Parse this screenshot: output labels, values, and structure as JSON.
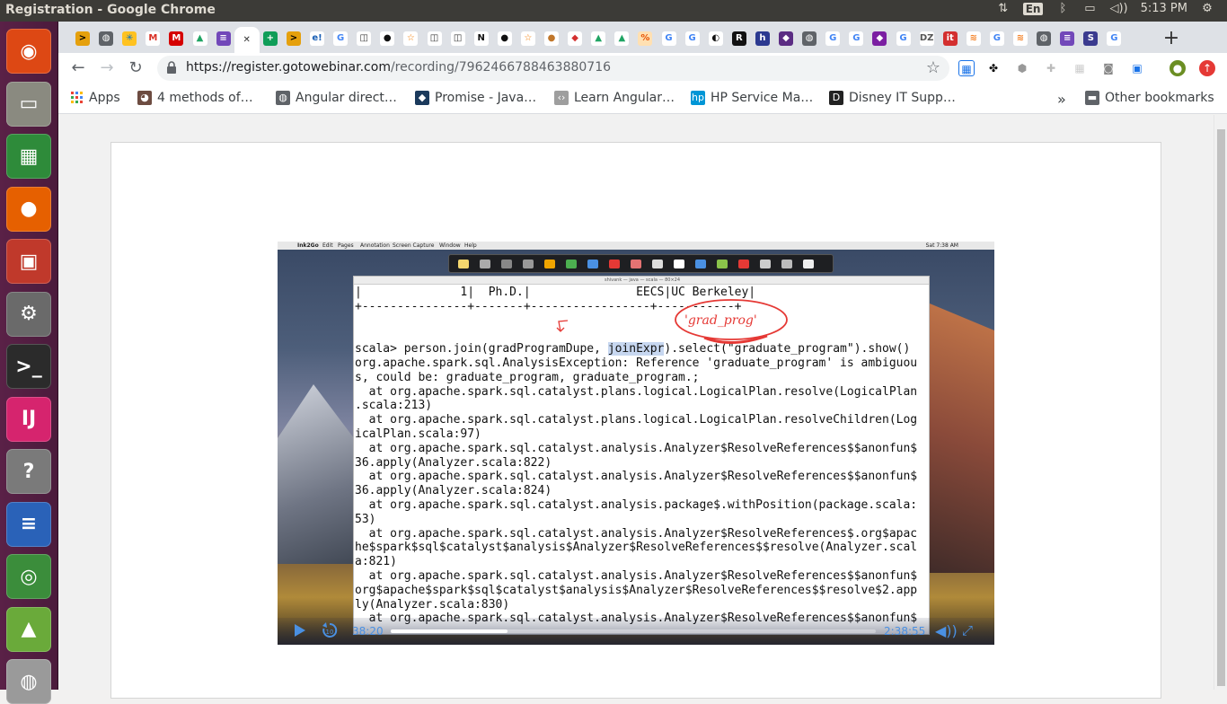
{
  "window": {
    "title": "Registration - Google Chrome"
  },
  "panel": {
    "lang": "En",
    "time": "5:13 PM"
  },
  "launcher": {
    "items": [
      {
        "name": "ubuntu-dash-icon",
        "glyph": "◉",
        "color": "#dd4814"
      },
      {
        "name": "files-icon",
        "glyph": "▭",
        "color": "#8a8a80"
      },
      {
        "name": "spreadsheet-icon",
        "glyph": "▦",
        "color": "#2e8b3a"
      },
      {
        "name": "firefox-icon",
        "glyph": "●",
        "color": "#e66000"
      },
      {
        "name": "presentation-icon",
        "glyph": "▣",
        "color": "#c0392b"
      },
      {
        "name": "system-settings-icon",
        "glyph": "⚙",
        "color": "#6a6a6a"
      },
      {
        "name": "terminal-icon",
        "glyph": ">_",
        "color": "#2b2b2b"
      },
      {
        "name": "intellij-icon",
        "glyph": "IJ",
        "color": "#d6246e"
      },
      {
        "name": "help-icon",
        "glyph": "?",
        "color": "#7a7a7a"
      },
      {
        "name": "writer-icon",
        "glyph": "≡",
        "color": "#2a62b8"
      },
      {
        "name": "chrome-icon",
        "glyph": "◎",
        "color": "#3b8d3b"
      },
      {
        "name": "image-viewer-icon",
        "glyph": "▲",
        "color": "#6aaa3a"
      },
      {
        "name": "disk-icon",
        "glyph": "◍",
        "color": "#9a9a9a"
      }
    ]
  },
  "tabs": [
    {
      "name": "tab-favicon-plex",
      "glyph": ">",
      "bg": "#e5a00d",
      "fg": "#000"
    },
    {
      "name": "tab-favicon-globe",
      "glyph": "◍",
      "bg": "#5f6368",
      "fg": "#fff"
    },
    {
      "name": "tab-favicon-walmart",
      "glyph": "✳",
      "bg": "#ffc220",
      "fg": "#0071ce"
    },
    {
      "name": "tab-favicon-gmail",
      "glyph": "M",
      "bg": "#ffffff",
      "fg": "#d93025"
    },
    {
      "name": "tab-favicon-m-red",
      "glyph": "M",
      "bg": "#d50000",
      "fg": "#fff"
    },
    {
      "name": "tab-favicon-drive",
      "glyph": "▲",
      "bg": "#ffffff",
      "fg": "#1fa463"
    },
    {
      "name": "tab-favicon-docs",
      "glyph": "≡",
      "bg": "#7248b9",
      "fg": "#fff"
    },
    {
      "name": "tab-favicon-close",
      "glyph": "✕",
      "bg": "#ffffff",
      "fg": "#333",
      "active": true
    },
    {
      "name": "tab-favicon-sheets",
      "glyph": "+",
      "bg": "#0f9d58",
      "fg": "#fff"
    },
    {
      "name": "tab-favicon-plex-2",
      "glyph": ">",
      "bg": "#e5a00d",
      "fg": "#000"
    },
    {
      "name": "tab-favicon-eloqua",
      "glyph": "e!",
      "bg": "#ffffff",
      "fg": "#1a5fb4"
    },
    {
      "name": "tab-favicon-google",
      "glyph": "G",
      "bg": "#ffffff",
      "fg": "#4285f4"
    },
    {
      "name": "tab-favicon-book",
      "glyph": "◫",
      "bg": "#ffffff",
      "fg": "#333"
    },
    {
      "name": "tab-favicon-github",
      "glyph": "●",
      "bg": "#ffffff",
      "fg": "#111"
    },
    {
      "name": "tab-favicon-star",
      "glyph": "☆",
      "bg": "#ffffff",
      "fg": "#f57c00"
    },
    {
      "name": "tab-favicon-book-2",
      "glyph": "◫",
      "bg": "#ffffff",
      "fg": "#333"
    },
    {
      "name": "tab-favicon-book-3",
      "glyph": "◫",
      "bg": "#ffffff",
      "fg": "#333"
    },
    {
      "name": "tab-favicon-notion",
      "glyph": "N",
      "bg": "#ffffff",
      "fg": "#111"
    },
    {
      "name": "tab-favicon-github-2",
      "glyph": "●",
      "bg": "#ffffff",
      "fg": "#111"
    },
    {
      "name": "tab-favicon-star-2",
      "glyph": "☆",
      "bg": "#ffffff",
      "fg": "#f57c00"
    },
    {
      "name": "tab-favicon-cookie",
      "glyph": "●",
      "bg": "#ffffff",
      "fg": "#c0762a"
    },
    {
      "name": "tab-favicon-stack",
      "glyph": "◆",
      "bg": "#ffffff",
      "fg": "#d32f2f"
    },
    {
      "name": "tab-favicon-drive-2",
      "glyph": "▲",
      "bg": "#ffffff",
      "fg": "#1fa463"
    },
    {
      "name": "tab-favicon-drive-3",
      "glyph": "▲",
      "bg": "#ffffff",
      "fg": "#1fa463"
    },
    {
      "name": "tab-favicon-percent",
      "glyph": "%",
      "bg": "#ffe0b2",
      "fg": "#e65100"
    },
    {
      "name": "tab-favicon-google-2",
      "glyph": "G",
      "bg": "#ffffff",
      "fg": "#4285f4"
    },
    {
      "name": "tab-favicon-google-3",
      "glyph": "G",
      "bg": "#ffffff",
      "fg": "#4285f4"
    },
    {
      "name": "tab-favicon-anaconda",
      "glyph": "◐",
      "bg": "#ffffff",
      "fg": "#111"
    },
    {
      "name": "tab-favicon-r",
      "glyph": "R",
      "bg": "#111111",
      "fg": "#fff"
    },
    {
      "name": "tab-favicon-h",
      "glyph": "h",
      "bg": "#2b3990",
      "fg": "#fff"
    },
    {
      "name": "tab-favicon-shield",
      "glyph": "◆",
      "bg": "#5b2c83",
      "fg": "#fff"
    },
    {
      "name": "tab-favicon-globe-2",
      "glyph": "◍",
      "bg": "#5f6368",
      "fg": "#fff"
    },
    {
      "name": "tab-favicon-google-4",
      "glyph": "G",
      "bg": "#ffffff",
      "fg": "#4285f4"
    },
    {
      "name": "tab-favicon-google-5",
      "glyph": "G",
      "bg": "#ffffff",
      "fg": "#4285f4"
    },
    {
      "name": "tab-favicon-cap",
      "glyph": "◆",
      "bg": "#7b1fa2",
      "fg": "#fff"
    },
    {
      "name": "tab-favicon-google-6",
      "glyph": "G",
      "bg": "#ffffff",
      "fg": "#4285f4"
    },
    {
      "name": "tab-favicon-dzone",
      "glyph": "DZ",
      "bg": "#ffffff",
      "fg": "#555"
    },
    {
      "name": "tab-favicon-it",
      "glyph": "it",
      "bg": "#d32f2f",
      "fg": "#fff"
    },
    {
      "name": "tab-favicon-stackoverflow",
      "glyph": "≋",
      "bg": "#ffffff",
      "fg": "#f48024"
    },
    {
      "name": "tab-favicon-google-7",
      "glyph": "G",
      "bg": "#ffffff",
      "fg": "#4285f4"
    },
    {
      "name": "tab-favicon-stackoverflow-2",
      "glyph": "≋",
      "bg": "#ffffff",
      "fg": "#f48024"
    },
    {
      "name": "tab-favicon-globe-3",
      "glyph": "◍",
      "bg": "#5f6368",
      "fg": "#fff"
    },
    {
      "name": "tab-favicon-docs-2",
      "glyph": "≡",
      "bg": "#7248b9",
      "fg": "#fff"
    },
    {
      "name": "tab-favicon-scala",
      "glyph": "S",
      "bg": "#3b3b8f",
      "fg": "#fff"
    },
    {
      "name": "tab-favicon-google-8",
      "glyph": "G",
      "bg": "#ffffff",
      "fg": "#4285f4"
    }
  ],
  "toolbar": {
    "url_host": "https://register.gotowebinar.com",
    "url_path": "/recording/7962466788463880716"
  },
  "bookmarks": {
    "apps_label": "Apps",
    "items": [
      {
        "name": "bookmark-4-methods",
        "label": "4 methods of…",
        "glyph": "◕",
        "color": "#6d4c41"
      },
      {
        "name": "bookmark-angular-direct",
        "label": "Angular direct…",
        "glyph": "◍",
        "color": "#5f6368"
      },
      {
        "name": "bookmark-promise-java",
        "label": "Promise - Java…",
        "glyph": "◆",
        "color": "#1b3a5c"
      },
      {
        "name": "bookmark-learn-angular",
        "label": "Learn Angular…",
        "glyph": "‹›",
        "color": "#9e9e9e"
      },
      {
        "name": "bookmark-hp-service",
        "label": "HP Service Ma…",
        "glyph": "hp",
        "color": "#0096d6"
      },
      {
        "name": "bookmark-disney-it",
        "label": "Disney IT Supp…",
        "glyph": "D",
        "color": "#222"
      }
    ],
    "overflow": "»",
    "other_label": "Other bookmarks"
  },
  "video": {
    "mac_menubar": [
      "Ink2Go",
      "Edit",
      "Pages",
      "Annotation",
      "Screen Capture",
      "Window",
      "Help"
    ],
    "mac_clock": "Sat 7:38 AM",
    "terminal_title": "shivank — java — scala — 80×24",
    "terminal_lines": [
      "|              1|  Ph.D.|               EECS|UC Berkeley|",
      "+---------------+-------+-----------------+-----------+",
      "",
      "",
      "scala> person.join(gradProgramDupe, joinExpr).select(\"graduate_program\").show()",
      "org.apache.spark.sql.AnalysisException: Reference 'graduate_program' is ambiguou",
      "s, could be: graduate_program, graduate_program.;",
      "  at org.apache.spark.sql.catalyst.plans.logical.LogicalPlan.resolve(LogicalPlan",
      ".scala:213)",
      "  at org.apache.spark.sql.catalyst.plans.logical.LogicalPlan.resolveChildren(Log",
      "icalPlan.scala:97)",
      "  at org.apache.spark.sql.catalyst.analysis.Analyzer$ResolveReferences$$anonfun$",
      "36.apply(Analyzer.scala:822)",
      "  at org.apache.spark.sql.catalyst.analysis.Analyzer$ResolveReferences$$anonfun$",
      "36.apply(Analyzer.scala:824)",
      "  at org.apache.spark.sql.catalyst.analysis.package$.withPosition(package.scala:",
      "53)",
      "  at org.apache.spark.sql.catalyst.analysis.Analyzer$ResolveReferences$.org$apac",
      "he$spark$sql$catalyst$analysis$Analyzer$ResolveReferences$$resolve(Analyzer.scal",
      "a:821)",
      "  at org.apache.spark.sql.catalyst.analysis.Analyzer$ResolveReferences$$anonfun$",
      "org$apache$spark$sql$catalyst$analysis$Analyzer$ResolveReferences$$resolve$2.app",
      "ly(Analyzer.scala:830)",
      "  at org.apache.spark.sql.catalyst.analysis.Analyzer$ResolveReferences$$anonfun$"
    ],
    "annotation_text": "'grad_prog'",
    "time_current": "38:20",
    "time_total": "2:38:55",
    "progress_fraction": 0.241
  }
}
